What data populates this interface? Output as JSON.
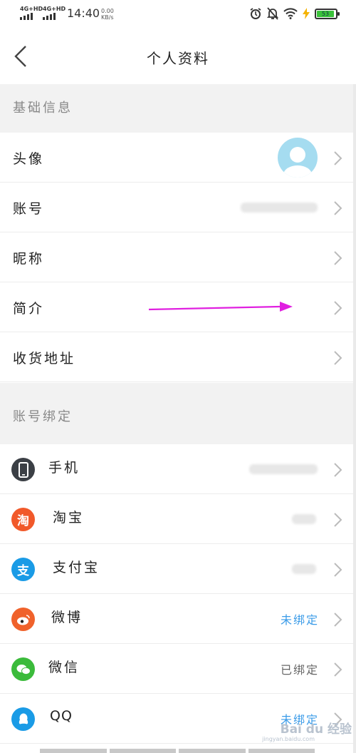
{
  "status_bar": {
    "signal1": "4G+HD",
    "signal2": "4G+HD",
    "time": "14:40",
    "speed_value": "0.00",
    "speed_unit": "KB/s",
    "battery": "53"
  },
  "header": {
    "title": "个人资料"
  },
  "basic_info": {
    "heading": "基础信息",
    "rows": [
      {
        "label": "头像"
      },
      {
        "label": "账号"
      },
      {
        "label": "昵称"
      },
      {
        "label": "简介"
      },
      {
        "label": "收货地址"
      }
    ]
  },
  "account_binding": {
    "heading": "账号绑定",
    "rows": [
      {
        "label": "手机",
        "icon": "phone-icon",
        "color": "#3b3f45"
      },
      {
        "label": "淘宝",
        "icon": "taobao-icon",
        "glyph": "淘",
        "color": "#f1592a"
      },
      {
        "label": "支付宝",
        "icon": "alipay-icon",
        "glyph": "支",
        "color": "#1a9be6"
      },
      {
        "label": "微博",
        "icon": "weibo-icon",
        "value": "未绑定",
        "color": "#f0622b"
      },
      {
        "label": "微信",
        "icon": "wechat-icon",
        "value": "已绑定",
        "color": "#3bbb3b"
      },
      {
        "label": "QQ",
        "icon": "qq-icon",
        "value": "未绑定",
        "color": "#1a9be6"
      }
    ]
  },
  "colors": {
    "link": "#3a9be8",
    "annotation_arrow": "#e020e0"
  },
  "watermark": {
    "text": "Bai du 经验",
    "sub": "jingyan.baidu.com"
  }
}
